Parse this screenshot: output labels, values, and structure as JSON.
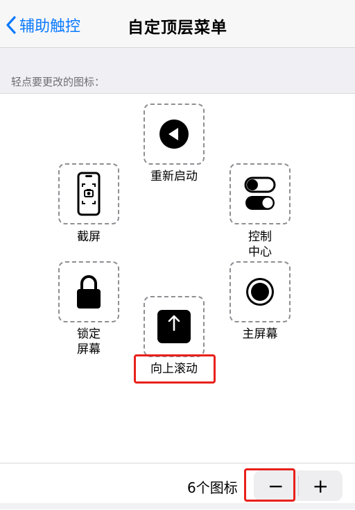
{
  "nav": {
    "back_label": "辅助触控",
    "title": "自定顶层菜单"
  },
  "section": {
    "hint": "轻点要更改的图标："
  },
  "icons": [
    {
      "label": "重新启动",
      "icon": "back-triangle-icon"
    },
    {
      "label": "截屏",
      "icon": "screenshot-phone-icon"
    },
    {
      "label": "控制\n中心",
      "icon": "toggle-switches-icon"
    },
    {
      "label": "锁定\n屏幕",
      "icon": "lock-icon"
    },
    {
      "label": "主屏幕",
      "icon": "home-button-icon"
    },
    {
      "label": "向上滚动",
      "icon": "scroll-up-icon"
    }
  ],
  "footer": {
    "count_label": "6个图标",
    "minus": "−",
    "plus": "+"
  },
  "colors": {
    "accent": "#0a7aff",
    "highlight": "#e8201a"
  }
}
